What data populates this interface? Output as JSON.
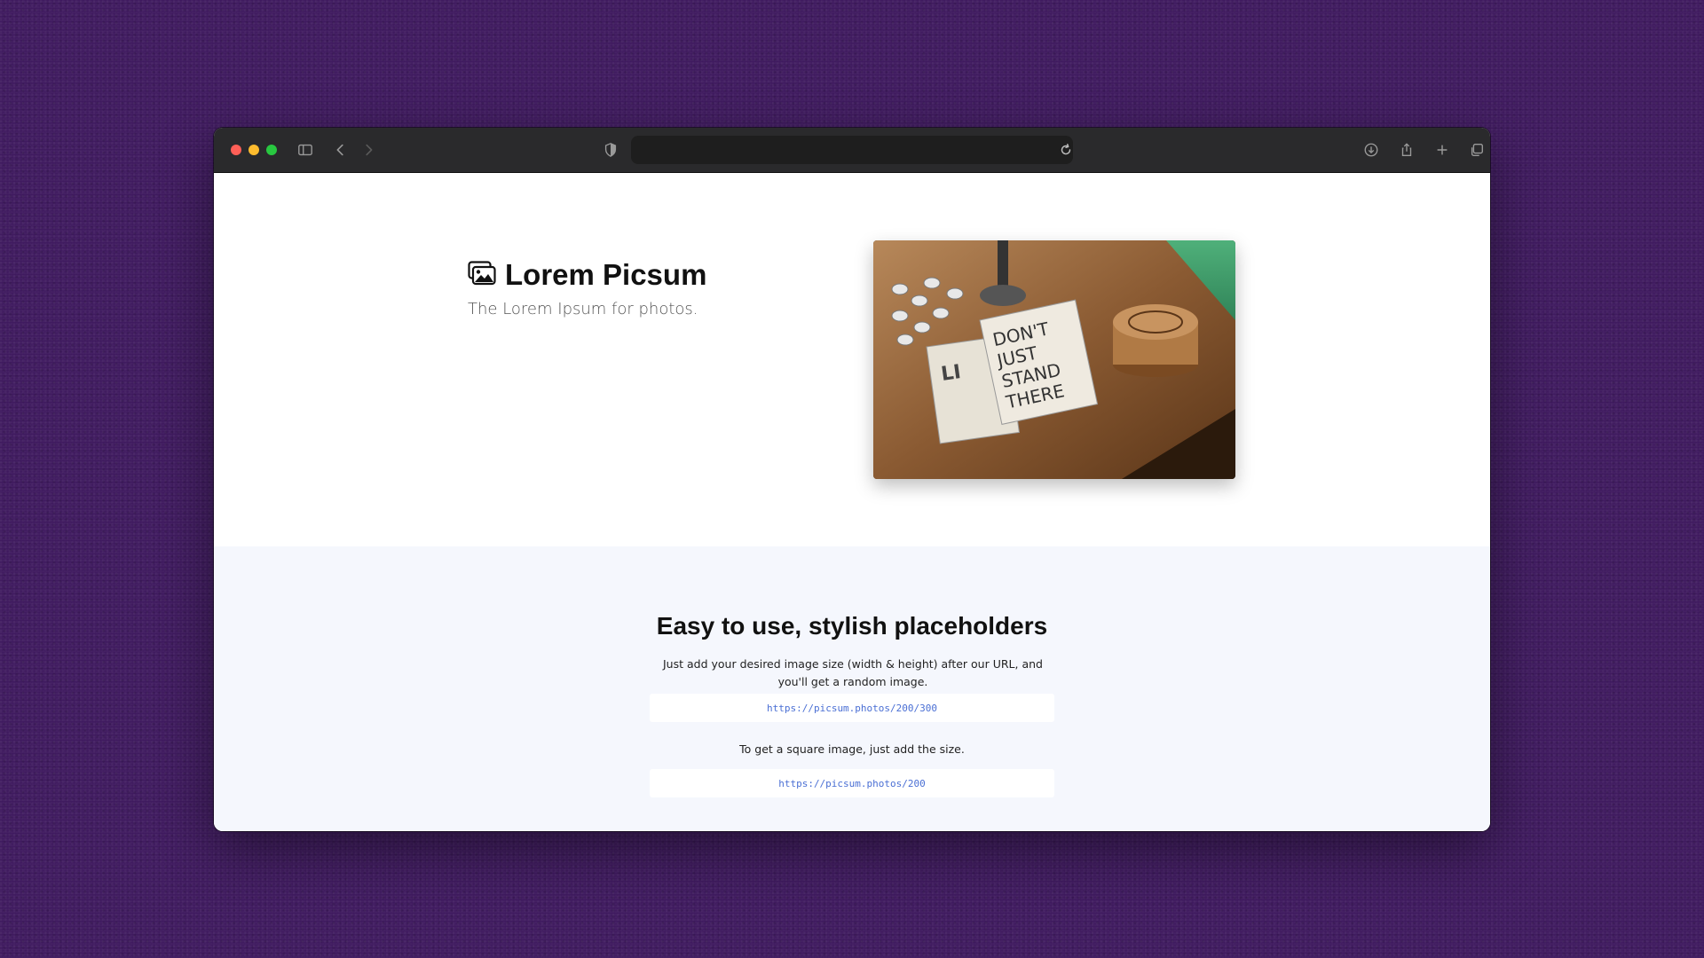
{
  "browser": {
    "url": ""
  },
  "hero": {
    "title": "Lorem Picsum",
    "tagline": "The Lorem Ipsum for photos."
  },
  "features": {
    "title": "Easy to use, stylish placeholders",
    "description": "Just add your desired image size (width & height) after our URL, and you'll get a random image.",
    "example_url_1": "https://picsum.photos/200/300",
    "square_note": "To get a square image, just add the size.",
    "example_url_2": "https://picsum.photos/200"
  },
  "colors": {
    "background": "#3f1a5f",
    "titlebar": "#2a2a2c",
    "features_bg": "#f5f7fd",
    "link": "#4a6fd4"
  }
}
